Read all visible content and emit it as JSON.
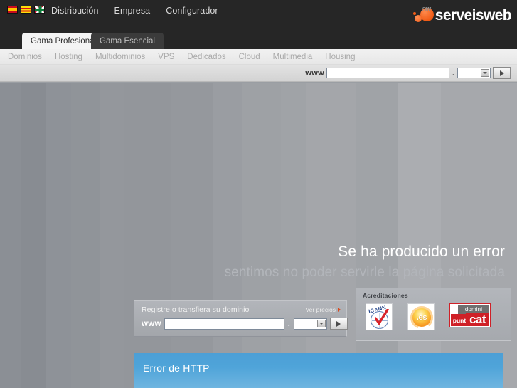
{
  "header": {
    "languages": [
      {
        "name": "spain-flag",
        "label": "Español"
      },
      {
        "name": "catalonia-flag",
        "label": "Català"
      },
      {
        "name": "basque-flag",
        "label": "Euskara"
      }
    ],
    "nav": [
      {
        "label": "Distribución"
      },
      {
        "label": "Empresa"
      },
      {
        "label": "Configurador"
      }
    ],
    "logo": {
      "text": "serveisweb",
      "mark_text": "SW",
      "accent": "#ef5c18"
    }
  },
  "tabs": [
    {
      "label": "Gama Profesional",
      "active": true
    },
    {
      "label": "Gama Esencial",
      "active": false
    }
  ],
  "subnav": [
    {
      "label": "Dominios"
    },
    {
      "label": "Hosting"
    },
    {
      "label": "Multidominios"
    },
    {
      "label": "VPS"
    },
    {
      "label": "Dedicados"
    },
    {
      "label": "Cloud"
    },
    {
      "label": "Multimedia"
    },
    {
      "label": "Housing"
    }
  ],
  "header_search": {
    "prefix": "www",
    "domain_value": "",
    "domain_placeholder": "",
    "separator": ".",
    "tld_value": "",
    "go_label": "go-arrow"
  },
  "error": {
    "headline": "Se ha producido un error",
    "subline": "sentimos no poder servirle la página solicitada"
  },
  "domain_box": {
    "title": "Registre o transfiera su dominio",
    "prices_link": "Ver precios",
    "prefix": "www",
    "domain_value": "",
    "domain_placeholder": "",
    "separator": ".",
    "tld_value": "",
    "go_label": "go-arrow"
  },
  "accreditations": {
    "title": "Acreditaciones",
    "badges": [
      {
        "name": "icann-badge",
        "text": "ICANN",
        "arc_text": "Internet Corporation for Assigned Names and Numbers"
      },
      {
        "name": "es-badge",
        "text": ".es"
      },
      {
        "name": "puntcat-badge",
        "line1": "domini",
        "line2": "punt",
        "line3": "cat"
      }
    ]
  },
  "http_error_panel": {
    "title": "Error de HTTP",
    "accent": "#4fa4d9"
  }
}
